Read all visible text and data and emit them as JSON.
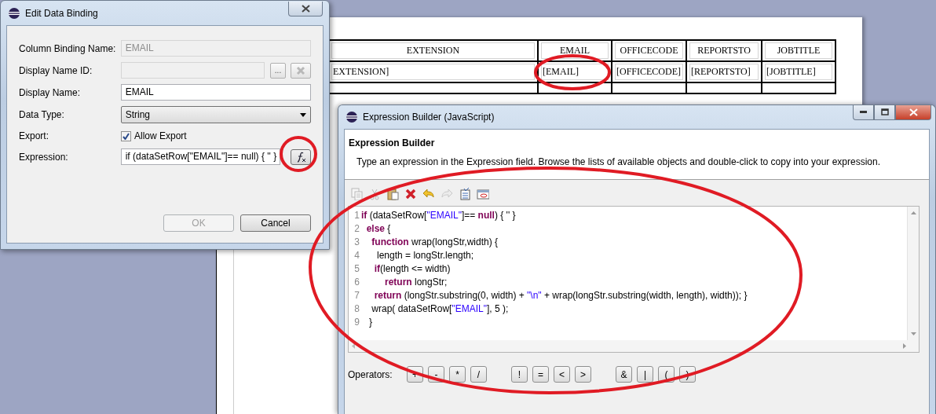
{
  "report_table": {
    "columns": [
      "EXTENSION",
      "EMAIL",
      "OFFICECODE",
      "REPORTSTO",
      "JOBTITLE"
    ],
    "rows": [
      [
        "EXTENSION]",
        "[EMAIL]",
        "[OFFICECODE]",
        "[REPORTSTO]",
        "[JOBTITLE]"
      ]
    ]
  },
  "edit_dialog": {
    "title": "Edit Data Binding",
    "column_binding_name": {
      "label": "Column Binding Name:",
      "value": "EMAIL",
      "disabled": true
    },
    "display_name_id": {
      "label": "Display Name ID:",
      "disabled": true,
      "browse_button": "..."
    },
    "display_name": {
      "label": "Display Name:",
      "value": "EMAIL"
    },
    "data_type": {
      "label": "Data Type:",
      "value": "String"
    },
    "export": {
      "label": "Export:",
      "option": "Allow Export",
      "checked": true
    },
    "expression": {
      "label": "Expression:",
      "value": "if (dataSetRow[\"EMAIL\"]== null) { '' }"
    },
    "buttons": [
      {
        "label": "OK",
        "disabled": true
      },
      {
        "label": "Cancel",
        "disabled": false
      }
    ]
  },
  "expression_builder": {
    "title": "Expression Builder (JavaScript)",
    "heading": "Expression Builder",
    "description": "Type an expression in the Expression field. Browse the lists of available objects and double-click to copy into your expression.",
    "toolbar": [
      {
        "kind": "copy",
        "disabled": true
      },
      {
        "kind": "cut",
        "disabled": true
      },
      {
        "kind": "paste",
        "disabled": false
      },
      {
        "kind": "delete",
        "disabled": false
      },
      {
        "kind": "undo",
        "disabled": false
      },
      {
        "kind": "redo",
        "disabled": true
      },
      {
        "kind": "checklist",
        "disabled": false
      },
      {
        "kind": "window",
        "disabled": false
      }
    ],
    "code_lines": [
      {
        "number": "1",
        "segments": [
          {
            "kind": "keyword",
            "text": "if"
          },
          {
            "kind": "plain",
            "text": " (dataSetRow["
          },
          {
            "kind": "string",
            "text": "\"EMAIL\""
          },
          {
            "kind": "plain",
            "text": "]== "
          },
          {
            "kind": "keyword",
            "text": "null"
          },
          {
            "kind": "plain",
            "text": ") { '' }"
          }
        ]
      },
      {
        "number": "2",
        "segments": [
          {
            "kind": "keyword",
            "text": "  else"
          },
          {
            "kind": "plain",
            "text": " {"
          }
        ]
      },
      {
        "number": "3",
        "segments": [
          {
            "kind": "keyword",
            "text": "    function"
          },
          {
            "kind": "plain",
            "text": " wrap(longStr,width) {"
          }
        ]
      },
      {
        "number": "4",
        "segments": [
          {
            "kind": "plain",
            "text": "      length = longStr.length;"
          }
        ]
      },
      {
        "number": "5",
        "segments": [
          {
            "kind": "keyword",
            "text": "     if"
          },
          {
            "kind": "plain",
            "text": "(length <= width)"
          }
        ]
      },
      {
        "number": "6",
        "segments": [
          {
            "kind": "keyword",
            "text": "         return"
          },
          {
            "kind": "plain",
            "text": " longStr;"
          }
        ]
      },
      {
        "number": "7",
        "segments": [
          {
            "kind": "keyword",
            "text": "     return"
          },
          {
            "kind": "plain",
            "text": " (longStr.substring(0, width) + "
          },
          {
            "kind": "string",
            "text": "\"\\n\""
          },
          {
            "kind": "plain",
            "text": " + wrap(longStr.substring(width, length), width)); }"
          }
        ]
      },
      {
        "number": "8",
        "segments": [
          {
            "kind": "plain",
            "text": "    wrap( dataSetRow["
          },
          {
            "kind": "string",
            "text": "\"EMAIL\""
          },
          {
            "kind": "plain",
            "text": "], 5 );"
          }
        ]
      },
      {
        "number": "9",
        "segments": [
          {
            "kind": "plain",
            "text": "   }"
          }
        ]
      }
    ],
    "operators_label": "Operators:",
    "operators": [
      "+",
      "-",
      "*",
      "/",
      "!",
      "=",
      "<",
      ">",
      "&",
      "|",
      "(",
      ")"
    ]
  },
  "highlights": [
    {
      "kind": "ellipse"
    },
    {
      "kind": "ellipse"
    },
    {
      "kind": "ellipse"
    }
  ]
}
